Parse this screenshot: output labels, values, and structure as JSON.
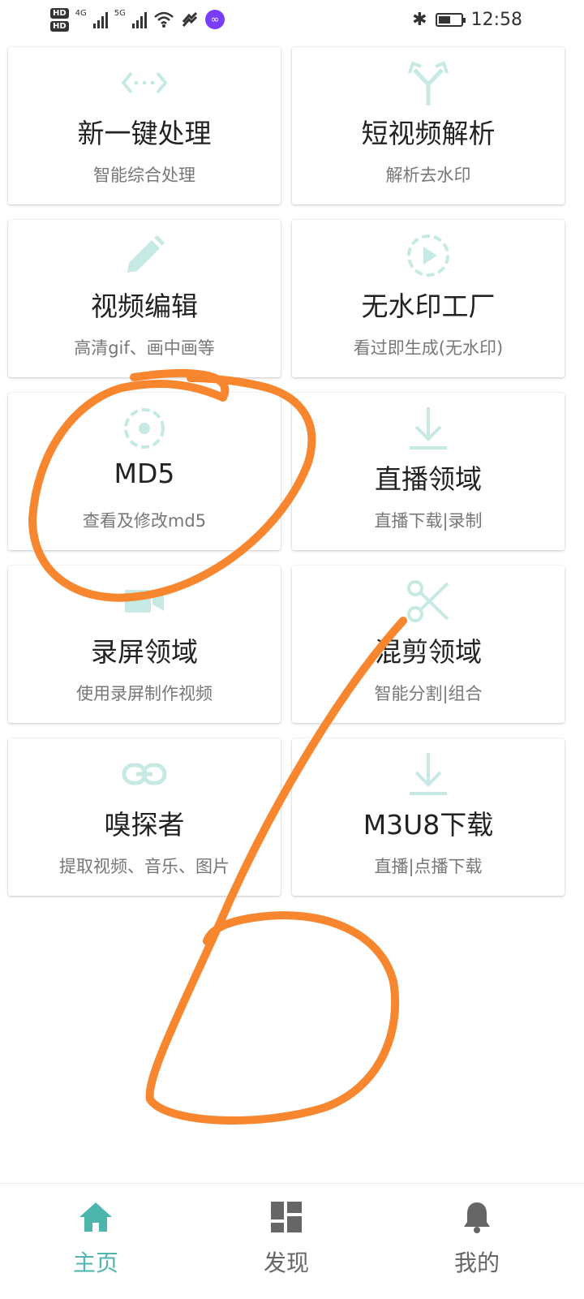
{
  "status_bar": {
    "hd1": "HD",
    "hd2": "HD",
    "net1": "4G",
    "net2": "5G",
    "time": "12:58",
    "battery_level": 0.55
  },
  "accent_color": "#4db6ac",
  "icon_color": "#c7e9e3",
  "cards": [
    {
      "title": "新一键处理",
      "subtitle": "智能综合处理",
      "icon": "arrows-icon"
    },
    {
      "title": "短视频解析",
      "subtitle": "解析去水印",
      "icon": "split-arrow-icon"
    },
    {
      "title": "视频编辑",
      "subtitle": "高清gif、画中画等",
      "icon": "pencil-icon"
    },
    {
      "title": "无水印工厂",
      "subtitle": "看过即生成(无水印)",
      "icon": "play-circle-icon"
    },
    {
      "title": "MD5",
      "subtitle": "查看及修改md5",
      "icon": "dashed-dot-circle-icon"
    },
    {
      "title": "直播领域",
      "subtitle": "直播下载|录制",
      "icon": "download-icon"
    },
    {
      "title": "录屏领域",
      "subtitle": "使用录屏制作视频",
      "icon": "video-camera-icon"
    },
    {
      "title": "混剪领域",
      "subtitle": "智能分割|组合",
      "icon": "scissors-icon"
    },
    {
      "title": "嗅探者",
      "subtitle": "提取视频、音乐、图片",
      "icon": "link-icon"
    },
    {
      "title": "M3U8下载",
      "subtitle": "直播|点播下载",
      "icon": "download-icon"
    }
  ],
  "nav": [
    {
      "label": "主页",
      "icon": "home-icon",
      "active": true
    },
    {
      "label": "发现",
      "icon": "grid-icon",
      "active": false
    },
    {
      "label": "我的",
      "icon": "bell-icon",
      "active": false
    }
  ],
  "annotation_color": "#f7862f"
}
